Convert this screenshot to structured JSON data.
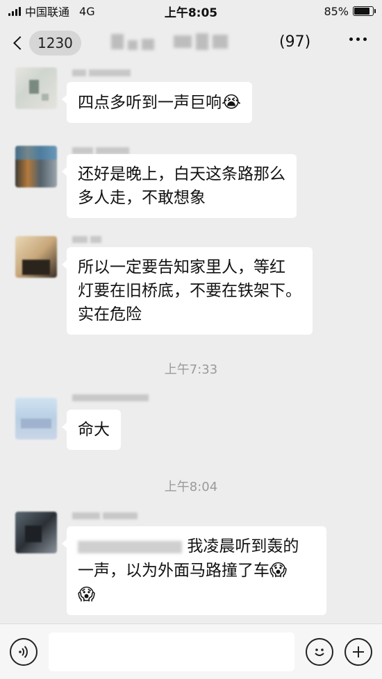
{
  "status_bar": {
    "carrier": "中国联通",
    "network": "4G",
    "time": "上午8:05",
    "battery_label": "85%",
    "battery_level": 0.85
  },
  "nav": {
    "badge": "1230",
    "member_count": "(97)"
  },
  "messages": [
    {
      "text": "四点多听到一声巨响",
      "emoji": "😭"
    },
    {
      "line1": "还好是晚上，白天这条路那么",
      "line2": "多人走，不敢想象"
    },
    {
      "line1": "所以一定要告知家里人，等红",
      "line2": "灯要在旧桥底，不要在铁架下。",
      "line3": "实在危险"
    },
    {
      "text": "命大"
    },
    {
      "line1": "我凌晨听到轰的",
      "line2": "一声，以为外面马路撞了车",
      "emoji": "😱"
    }
  ],
  "timestamps": [
    "上午7:33",
    "上午8:04"
  ],
  "icons": {
    "voice": "voice-icon",
    "emoji": "emoji-icon",
    "plus": "plus-icon",
    "back": "back-icon",
    "more": "more-icon"
  }
}
